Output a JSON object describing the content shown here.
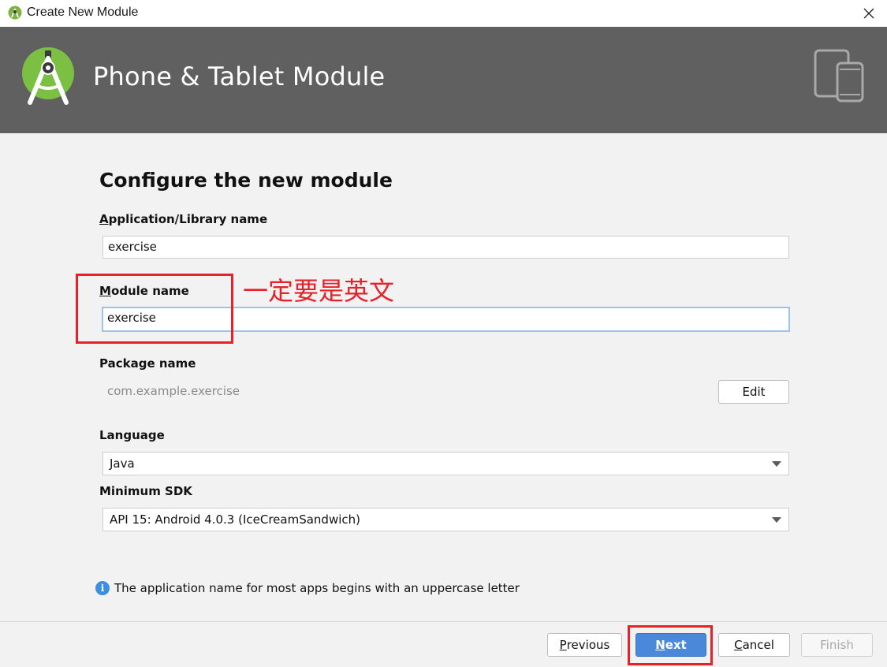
{
  "window": {
    "title": "Create New Module",
    "close_icon": "close-icon"
  },
  "header": {
    "title": "Phone & Tablet Module",
    "logo_icon": "android-studio-logo",
    "device_icon": "phone-tablet-icon",
    "background": "#606060"
  },
  "form": {
    "section_title": "Configure the new module",
    "app_name": {
      "label_mnemonic": "A",
      "label_rest": "pplication/Library name",
      "value": "exercise"
    },
    "module_name": {
      "label_mnemonic": "M",
      "label_rest": "odule name",
      "value": "exercise"
    },
    "package_name": {
      "label": "Package name",
      "value": "com.example.exercise",
      "edit_label": "Edit"
    },
    "language": {
      "label": "Language",
      "selected": "Java"
    },
    "min_sdk": {
      "label": "Minimum SDK",
      "selected": "API 15: Android 4.0.3 (IceCreamSandwich)"
    },
    "info_text": "The application name for most apps begins with an uppercase letter"
  },
  "footer": {
    "previous": {
      "mnemonic": "P",
      "rest": "revious"
    },
    "next": {
      "mnemonic": "N",
      "rest": "ext"
    },
    "cancel": {
      "mnemonic": "C",
      "rest": "ancel"
    },
    "finish": "Finish"
  },
  "annotation": {
    "text": "一定要是英文",
    "color": "#e8202a"
  },
  "colors": {
    "accent": "#4a88d9",
    "focus_border": "#9cc3ea",
    "info": "#3d8ee0"
  }
}
